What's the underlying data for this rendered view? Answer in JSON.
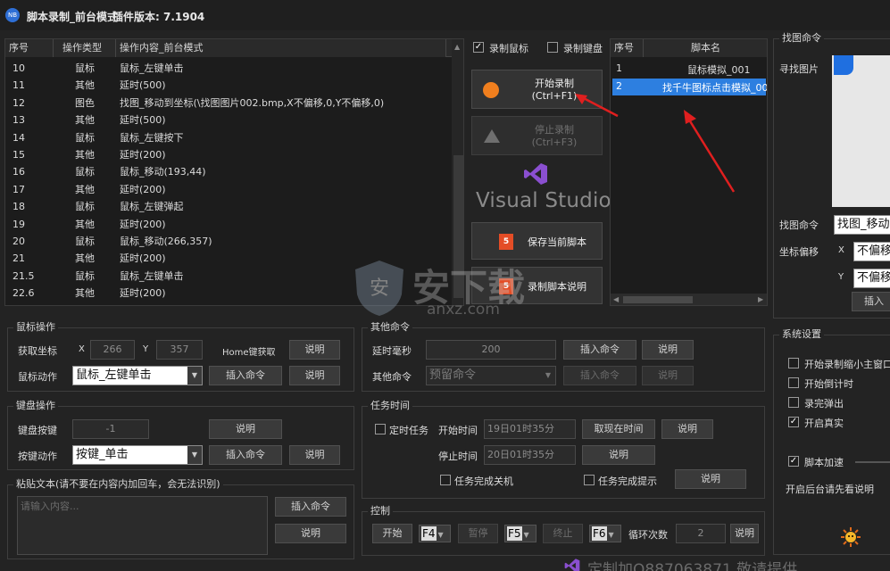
{
  "titlebar": {
    "app_name": "脚本录制_前台模式",
    "version_text": "插件版本: 7.1904",
    "icon_text": "NB"
  },
  "record_table": {
    "headers": [
      "序号",
      "操作类型",
      "操作内容_前台模式"
    ],
    "rows": [
      [
        "10",
        "鼠标",
        "鼠标_左键单击"
      ],
      [
        "11",
        "其他",
        "延时(500)"
      ],
      [
        "12",
        "图色",
        "找图_移动到坐标(\\找图图片002.bmp,X不偏移,0,Y不偏移,0)"
      ],
      [
        "13",
        "其他",
        "延时(500)"
      ],
      [
        "14",
        "鼠标",
        "鼠标_左键按下"
      ],
      [
        "15",
        "其他",
        "延时(200)"
      ],
      [
        "16",
        "鼠标",
        "鼠标_移动(193,44)"
      ],
      [
        "17",
        "其他",
        "延时(200)"
      ],
      [
        "18",
        "鼠标",
        "鼠标_左键弹起"
      ],
      [
        "19",
        "其他",
        "延时(200)"
      ],
      [
        "20",
        "鼠标",
        "鼠标_移动(266,357)"
      ],
      [
        "21",
        "其他",
        "延时(200)"
      ],
      [
        "21.5",
        "鼠标",
        "鼠标_左键单击"
      ],
      [
        "22.6",
        "其他",
        "延时(200)"
      ]
    ]
  },
  "record_options": {
    "record_mouse": "录制鼠标",
    "record_keyboard": "录制键盘"
  },
  "actions": {
    "start_line1": "开始录制",
    "start_line2": "(Ctrl+F1)",
    "stop_line1": "停止录制",
    "stop_line2": "(Ctrl+F3)",
    "vs_text": "Visual Studio",
    "save": "保存当前脚本",
    "explain": "录制脚本说明"
  },
  "script_list": {
    "headers": [
      "序号",
      "脚本名"
    ],
    "rows": [
      [
        "1",
        "鼠标模拟_001"
      ],
      [
        "2",
        "找千牛图标点击模拟_00"
      ]
    ]
  },
  "find_image": {
    "group": "找图命令",
    "find_label": "寻找图片",
    "cmd_label": "找图命令",
    "cmd_value": "找图_移动",
    "offset_label": "坐标偏移",
    "x": "X",
    "y": "Y",
    "x_value": "不偏移",
    "y_value": "不偏移",
    "insert": "插入"
  },
  "mouse_group": {
    "title": "鼠标操作",
    "get_coord": "获取坐标",
    "x_label": "X",
    "x_value": "266",
    "y_label": "Y",
    "y_value": "357",
    "home_key": "Home键获取",
    "explain": "说明",
    "action_label": "鼠标动作",
    "action_value": "鼠标_左键单击",
    "insert": "插入命令",
    "explain2": "说明"
  },
  "other_group": {
    "title": "其他命令",
    "delay_label": "延时毫秒",
    "delay_value": "200",
    "insert": "插入命令",
    "explain": "说明",
    "other_label": "其他命令",
    "other_value": "预留命令",
    "insert2": "插入命令",
    "explain2": "说明"
  },
  "keyboard_group": {
    "title": "键盘操作",
    "key_label": "键盘按键",
    "key_value": "-1",
    "explain": "说明",
    "action_label": "按键动作",
    "action_value": "按键_单击",
    "insert": "插入命令",
    "explain2": "说明"
  },
  "task_group": {
    "title": "任务时间",
    "timed": "定时任务",
    "start_label": "开始时间",
    "start_value": "19日01时35分",
    "get_now": "取现在时间",
    "explain": "说明",
    "stop_label": "停止时间",
    "stop_value": "20日01时35分",
    "explain2": "说明",
    "shutdown": "任务完成关机",
    "notify": "任务完成提示",
    "explain3": "说明"
  },
  "paste_group": {
    "title": "粘贴文本(请不要在内容内加回车，会无法识别)",
    "placeholder": "请输入内容...",
    "insert": "插入命令",
    "explain": "说明"
  },
  "control_group": {
    "title": "控制",
    "start": "开始",
    "start_key": "F4",
    "pause": "暂停",
    "pause_key": "F5",
    "stop": "终止",
    "stop_key": "F6",
    "loop_label": "循环次数",
    "loop_value": "2",
    "explain": "说明"
  },
  "system_group": {
    "title": "系统设置",
    "opt1": "开始录制缩小主窗口",
    "opt2": "开始倒计时",
    "opt3": "录完弹出",
    "opt4": "开启真实",
    "speed": "脚本加速",
    "note": "开启后台请先看说明"
  },
  "watermark": {
    "main": "安下载",
    "sub": "anxz.com"
  },
  "bottom_text": "定制加Q887063871  敬请提供"
}
